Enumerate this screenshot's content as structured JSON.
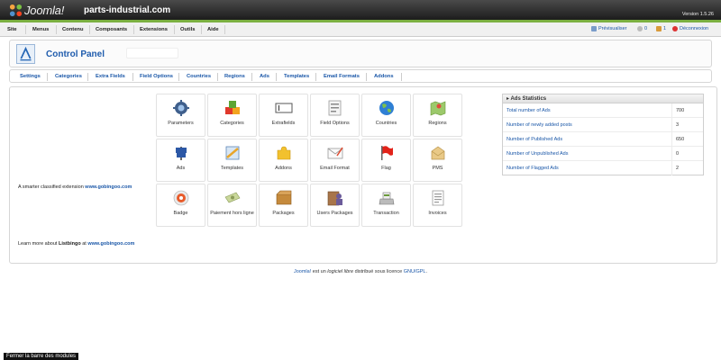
{
  "header": {
    "logo_text": "Joomla!",
    "site_name": "parts-industrial.com",
    "version": "Version 1.5.26"
  },
  "menu": [
    "Site",
    "Menus",
    "Contenu",
    "Composants",
    "Extensions",
    "Outils",
    "Aide"
  ],
  "status": {
    "preview": "Prévisualiser",
    "messages_count": "0",
    "users_count": "1",
    "logout": "Déconnexion"
  },
  "page_title": "Control Panel",
  "tabs": [
    "Settings",
    "Categories",
    "Extra Fields",
    "Field Options",
    "Countries",
    "Regions",
    "Ads",
    "Templates",
    "Email Formats",
    "Addons"
  ],
  "left": {
    "tagline_prefix": "A smarter classified extension",
    "tagline_link": "www.gobingoo.com",
    "learn_prefix": "Learn more about",
    "learn_product": "Listbingo",
    "learn_mid": "at",
    "learn_link": "www.gobingoo.com"
  },
  "icons": [
    {
      "label": "Parameters",
      "icon": "gear-icon"
    },
    {
      "label": "Categories",
      "icon": "blocks-icon"
    },
    {
      "label": "Extrafields",
      "icon": "textfield-icon"
    },
    {
      "label": "Field Options",
      "icon": "list-icon"
    },
    {
      "label": "Countries",
      "icon": "globe-icon"
    },
    {
      "label": "Regions",
      "icon": "map-icon"
    },
    {
      "label": "Ads",
      "icon": "signpost-icon"
    },
    {
      "label": "Templates",
      "icon": "template-icon"
    },
    {
      "label": "Addons",
      "icon": "puzzle-icon"
    },
    {
      "label": "Email Format",
      "icon": "email-icon"
    },
    {
      "label": "Flag",
      "icon": "flag-icon"
    },
    {
      "label": "PMS",
      "icon": "pms-icon"
    },
    {
      "label": "Badge",
      "icon": "badge-icon"
    },
    {
      "label": "Paiement hors ligne",
      "icon": "payment-icon"
    },
    {
      "label": "Packages",
      "icon": "package-icon"
    },
    {
      "label": "Users Packages",
      "icon": "users-package-icon"
    },
    {
      "label": "Transaction",
      "icon": "register-icon"
    },
    {
      "label": "Invoices",
      "icon": "invoice-icon"
    }
  ],
  "stats": {
    "title": "Ads Statistics",
    "rows": [
      {
        "label": "Total number of Ads",
        "value": "700"
      },
      {
        "label": "Number of newly added posts",
        "value": "3"
      },
      {
        "label": "Number of Published Ads",
        "value": "650"
      },
      {
        "label": "Number of Unpublished Ads",
        "value": "0"
      },
      {
        "label": "Number of Flagged Ads",
        "value": "2"
      }
    ]
  },
  "footer": {
    "link1": "Joomla!",
    "text1": "est un",
    "text2": "logiciel libre",
    "text3": "distribué sous licence",
    "link2": "GNU/GPL",
    "end": "."
  },
  "close_bar": "Fermer la barre des modules",
  "colors": {
    "link": "#1a57a8",
    "header_green": "#7bb041"
  }
}
